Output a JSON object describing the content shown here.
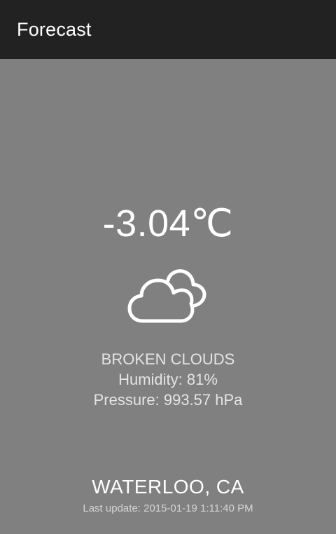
{
  "app_bar": {
    "title": "Forecast"
  },
  "weather": {
    "temperature": "-3.04℃",
    "icon": "broken-clouds-icon",
    "description": "BROKEN CLOUDS",
    "humidity": "Humidity: 81%",
    "pressure": "Pressure: 993.57 hPa"
  },
  "location": {
    "city": "WATERLOO, CA",
    "last_update": "Last update: 2015-01-19 1:11:40 PM"
  },
  "colors": {
    "background": "#808080",
    "app_bar": "#222222",
    "text_primary": "#ffffff",
    "text_secondary": "#e4e4e4"
  }
}
